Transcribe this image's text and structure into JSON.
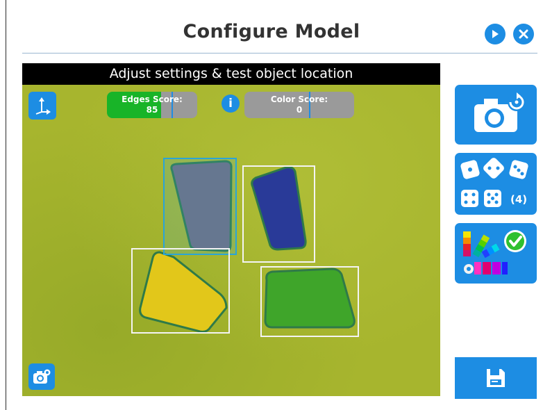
{
  "header": {
    "title": "Configure Model",
    "play_icon": "play-icon",
    "close_icon": "close-icon"
  },
  "viewer": {
    "title": "Adjust settings & test object location",
    "edges_score": {
      "label": "Edges Score:",
      "value": "85",
      "fill_fraction": 0.6
    },
    "color_score": {
      "label": "Color Score:",
      "value": "0",
      "fill_fraction": 0.0
    },
    "objects": [
      {
        "color": "gray",
        "selected": true
      },
      {
        "color": "blue",
        "selected": false
      },
      {
        "color": "yellow",
        "selected": false
      },
      {
        "color": "green",
        "selected": false
      }
    ]
  },
  "side_panel": {
    "dice_count": "(4)",
    "buttons": [
      "camera-refresh-button",
      "dice-button",
      "color-palette-button",
      "save-button"
    ]
  },
  "colors": {
    "accent": "#1d8de3",
    "green": "#18b428",
    "background": "#a7b52e"
  }
}
